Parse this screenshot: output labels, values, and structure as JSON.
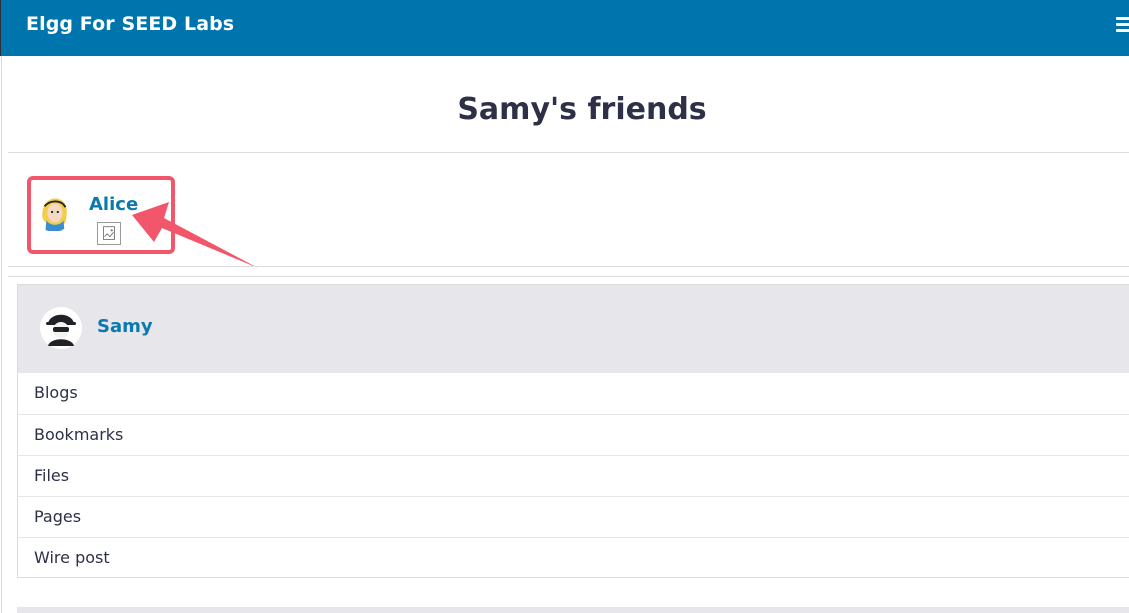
{
  "header": {
    "site_title": "Elgg For SEED Labs",
    "menu_icon": "hamburger-menu-icon",
    "background_color": "#0075ad"
  },
  "page": {
    "title": "Samy's friends"
  },
  "friends": [
    {
      "name": "Alice",
      "avatar": "alice-avatar-image",
      "badge_icon": "broken-image-icon"
    }
  ],
  "annotation": {
    "highlight_color": "#f2566b",
    "type": "arrow-and-box"
  },
  "owner_block": {
    "name": "Samy",
    "avatar": "spy-avatar-icon",
    "menu": [
      "Blogs",
      "Bookmarks",
      "Files",
      "Pages",
      "Wire post"
    ]
  },
  "colors": {
    "link": "#0b79ad",
    "text": "#2d3047",
    "panel": "#e6e6eb"
  }
}
